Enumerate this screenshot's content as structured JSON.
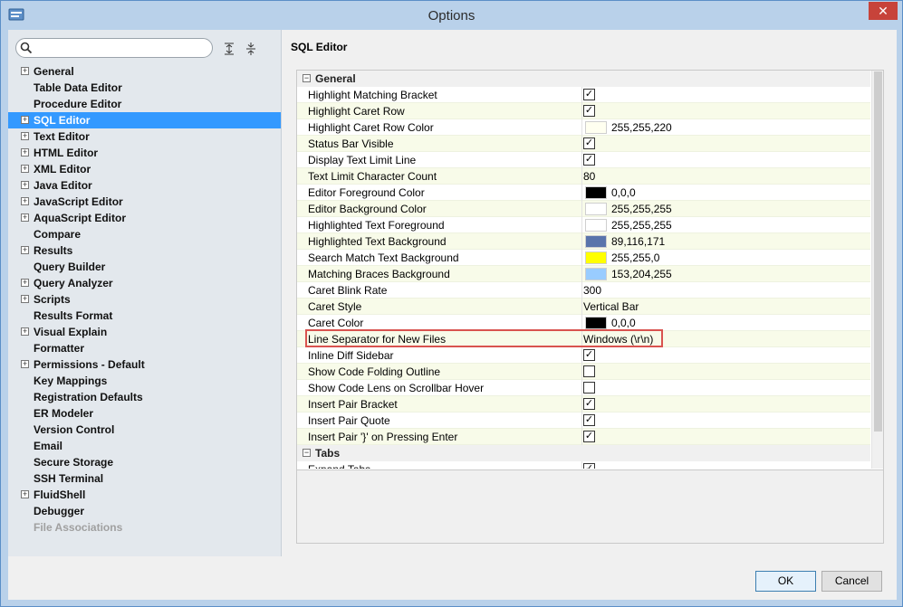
{
  "window": {
    "title": "Options",
    "close_glyph": "✕"
  },
  "search": {
    "placeholder": "",
    "value": ""
  },
  "tree": [
    {
      "label": "General",
      "expandable": true
    },
    {
      "label": "Table Data Editor",
      "expandable": false
    },
    {
      "label": "Procedure Editor",
      "expandable": false
    },
    {
      "label": "SQL Editor",
      "expandable": true,
      "selected": true
    },
    {
      "label": "Text Editor",
      "expandable": true
    },
    {
      "label": "HTML Editor",
      "expandable": true
    },
    {
      "label": "XML Editor",
      "expandable": true
    },
    {
      "label": "Java Editor",
      "expandable": true
    },
    {
      "label": "JavaScript Editor",
      "expandable": true
    },
    {
      "label": "AquaScript Editor",
      "expandable": true
    },
    {
      "label": "Compare",
      "expandable": false
    },
    {
      "label": "Results",
      "expandable": true
    },
    {
      "label": "Query Builder",
      "expandable": false
    },
    {
      "label": "Query Analyzer",
      "expandable": true
    },
    {
      "label": "Scripts",
      "expandable": true
    },
    {
      "label": "Results Format",
      "expandable": false
    },
    {
      "label": "Visual Explain",
      "expandable": true
    },
    {
      "label": "Formatter",
      "expandable": false
    },
    {
      "label": "Permissions - Default",
      "expandable": true
    },
    {
      "label": "Key Mappings",
      "expandable": false
    },
    {
      "label": "Registration Defaults",
      "expandable": false
    },
    {
      "label": "ER Modeler",
      "expandable": false
    },
    {
      "label": "Version Control",
      "expandable": false
    },
    {
      "label": "Email",
      "expandable": false
    },
    {
      "label": "Secure Storage",
      "expandable": false
    },
    {
      "label": "SSH Terminal",
      "expandable": false
    },
    {
      "label": "FluidShell",
      "expandable": true
    },
    {
      "label": "Debugger",
      "expandable": false
    },
    {
      "label": "File Associations",
      "expandable": false,
      "disabled": true
    }
  ],
  "panel": {
    "title": "SQL Editor"
  },
  "categories": [
    {
      "label": "General",
      "properties": [
        {
          "name": "Highlight Matching Bracket",
          "type": "checkbox",
          "checked": true
        },
        {
          "name": "Highlight Caret Row",
          "type": "checkbox",
          "checked": true
        },
        {
          "name": "Highlight Caret Row Color",
          "type": "color",
          "color": "#fffff0",
          "value": "255,255,220"
        },
        {
          "name": "Status Bar Visible",
          "type": "checkbox",
          "checked": true
        },
        {
          "name": "Display Text Limit Line",
          "type": "checkbox",
          "checked": true
        },
        {
          "name": "Text Limit Character Count",
          "type": "text",
          "value": "80"
        },
        {
          "name": "Editor Foreground Color",
          "type": "color",
          "color": "#000000",
          "value": "0,0,0"
        },
        {
          "name": "Editor Background Color",
          "type": "color",
          "color": "#ffffff",
          "value": "255,255,255"
        },
        {
          "name": "Highlighted Text Foreground",
          "type": "color",
          "color": "#ffffff",
          "value": "255,255,255"
        },
        {
          "name": "Highlighted Text Background",
          "type": "color",
          "color": "#5974ab",
          "value": "89,116,171"
        },
        {
          "name": "Search Match Text Background",
          "type": "color",
          "color": "#ffff00",
          "value": "255,255,0"
        },
        {
          "name": "Matching Braces Background",
          "type": "color",
          "color": "#99ccff",
          "value": "153,204,255"
        },
        {
          "name": "Caret Blink Rate",
          "type": "text",
          "value": "300"
        },
        {
          "name": "Caret Style",
          "type": "text",
          "value": "Vertical Bar"
        },
        {
          "name": "Caret Color",
          "type": "color",
          "color": "#000000",
          "value": "0,0,0"
        },
        {
          "name": "Line Separator for New Files",
          "type": "text",
          "value": "Windows (\\r\\n)",
          "highlighted": true
        },
        {
          "name": "Inline Diff Sidebar",
          "type": "checkbox",
          "checked": true
        },
        {
          "name": "Show Code Folding Outline",
          "type": "checkbox",
          "checked": false
        },
        {
          "name": "Show Code Lens on Scrollbar Hover",
          "type": "checkbox",
          "checked": false
        },
        {
          "name": "Insert Pair Bracket",
          "type": "checkbox",
          "checked": true
        },
        {
          "name": "Insert Pair Quote",
          "type": "checkbox",
          "checked": true
        },
        {
          "name": "Insert Pair '}' on Pressing Enter",
          "type": "checkbox",
          "checked": true
        }
      ]
    },
    {
      "label": "Tabs",
      "properties": [
        {
          "name": "Expand Tabs",
          "type": "checkbox",
          "checked": true
        }
      ]
    }
  ],
  "buttons": {
    "ok": "OK",
    "cancel": "Cancel"
  },
  "glyphs": {
    "expand": "+",
    "collapse": "−",
    "check": "✓"
  }
}
